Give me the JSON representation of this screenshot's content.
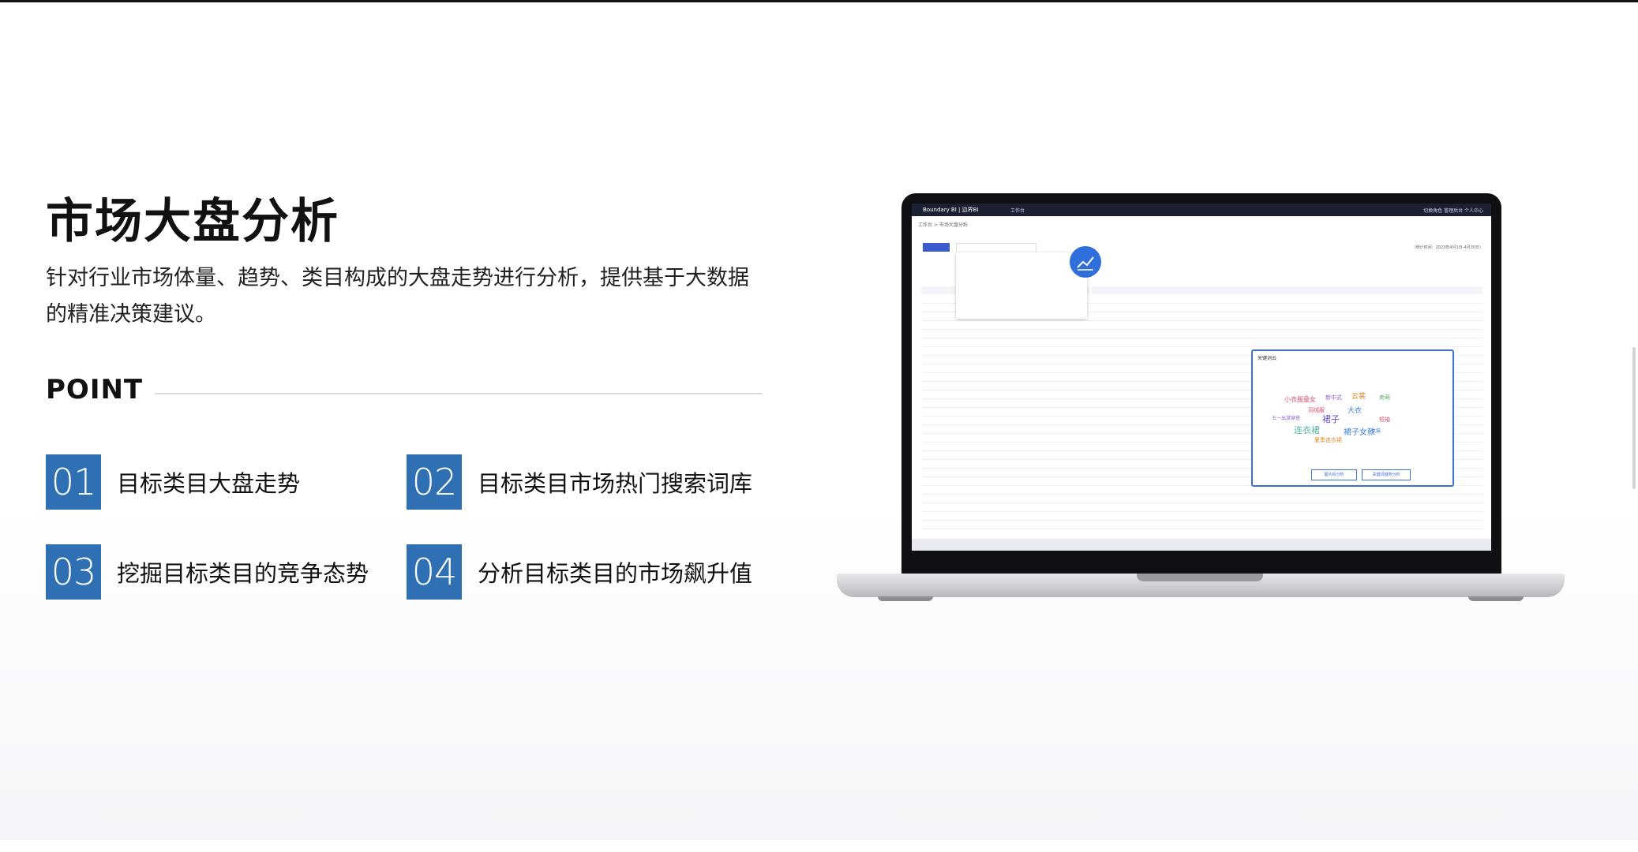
{
  "hero": {
    "title": "市场大盘分析",
    "description": "针对行业市场体量、趋势、类目构成的大盘走势进行分析，提供基于大数据的精准决策建议。"
  },
  "point": {
    "label": "POINT",
    "items": [
      {
        "num": "01",
        "text": "目标类目大盘走势"
      },
      {
        "num": "02",
        "text": "目标类目市场热门搜索词库"
      },
      {
        "num": "03",
        "text": "挖掘目标类目的竞争态势"
      },
      {
        "num": "04",
        "text": "分析目标类目的市场飙升值"
      }
    ]
  },
  "laptop_screen": {
    "brand": "Boundary BI | 边界BI",
    "nav_item": "工作台",
    "top_right": "切换角色   管理后台   个人中心",
    "breadcrumb": "工作台 > 市场大盘分析",
    "date_range": "（统计时间：2023年4月1日-4月30日）",
    "popup_title": "关键词云",
    "popup_buttons": [
      "图片拆分析",
      "关键词趋势分析"
    ],
    "cloud_words": [
      "小衣服童女",
      "新中式",
      "云裳",
      "卖萌",
      "大衣",
      "羽绒服",
      "连衣裙",
      "裙子",
      "裙子女款",
      "夏季连衣裙",
      "五一出游穿搭",
      "短袖",
      "女装"
    ]
  },
  "colors": {
    "accent": "#2f6fb3",
    "screen_accent": "#3d6fd6"
  }
}
